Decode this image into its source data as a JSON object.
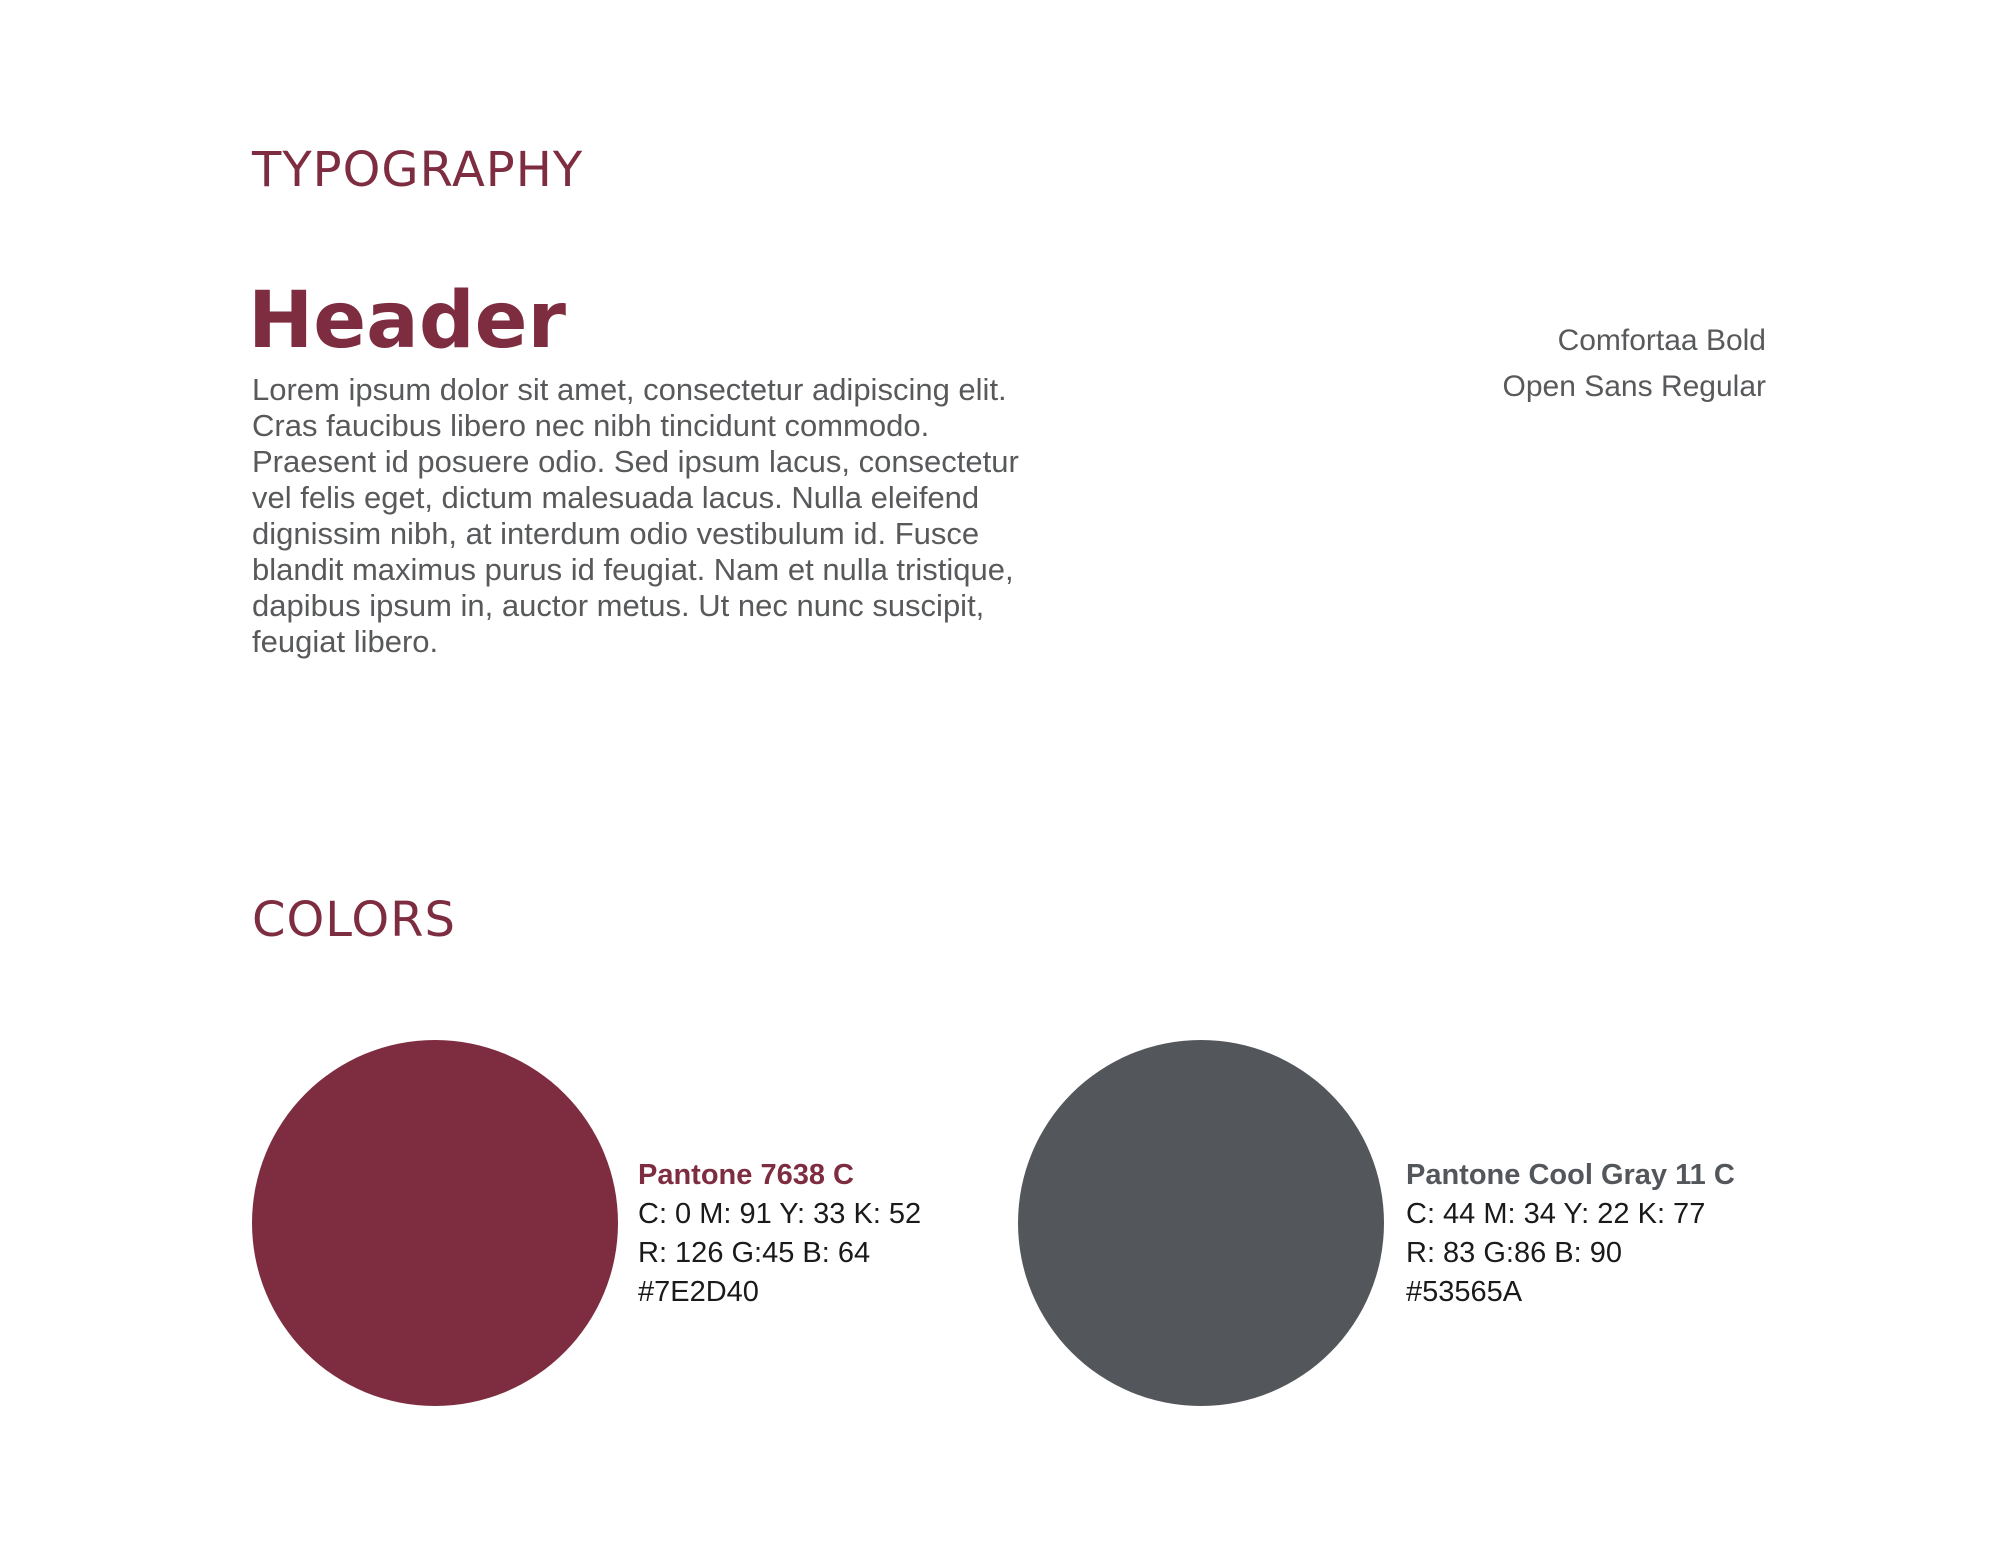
{
  "typography": {
    "title": "TYPOGRAPHY",
    "header_sample": "Header",
    "body_sample": "Lorem ipsum dolor sit amet, consectetur adipiscing elit. Cras faucibus libero nec nibh tincidunt commodo. Praesent id posuere odio. Sed ipsum lacus, consectetur vel felis eget, dictum malesuada lacus. Nulla eleifend dignissim nibh, at interdum odio vestibulum id. Fusce blandit maximus purus id feugiat. Nam et nulla tristique, dapibus ipsum in, auctor metus. Ut nec nunc suscipit, feugiat libero.",
    "fonts": [
      "Comfortaa Bold",
      "Open Sans Regular"
    ]
  },
  "colors": {
    "title": "COLORS",
    "swatches": [
      {
        "name": "Pantone 7638 C",
        "cmyk": "C: 0  M: 91  Y: 33  K: 52",
        "rgb": "R: 126  G:45  B: 64",
        "hex": "#7E2D40"
      },
      {
        "name": "Pantone Cool Gray 11 C",
        "cmyk": "C: 44  M: 34  Y: 22  K: 77",
        "rgb": "R: 83  G:86  B: 90",
        "hex": "#53565A"
      }
    ]
  }
}
